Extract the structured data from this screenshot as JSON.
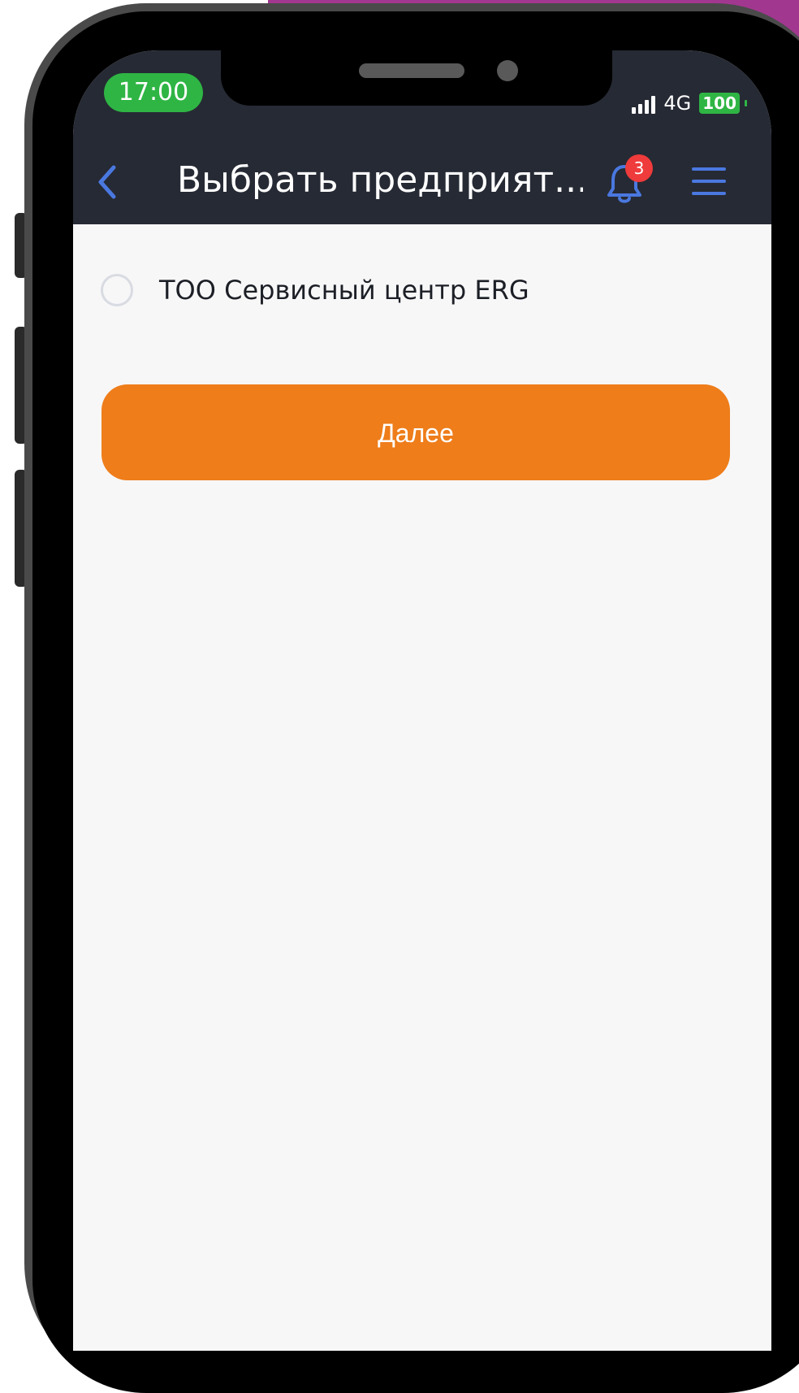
{
  "status_bar": {
    "time": "17:00",
    "network": "4G",
    "battery": "100"
  },
  "header": {
    "title": "Выбрать предприят...",
    "notification_count": "3",
    "back_icon": "chevron-left-icon",
    "bell_icon": "bell-icon",
    "menu_icon": "hamburger-menu-icon"
  },
  "options": [
    {
      "label": "ТОО Сервисный центр ERG",
      "selected": false
    }
  ],
  "actions": {
    "next_label": "Далее"
  },
  "colors": {
    "header_bg": "#262a34",
    "accent_blue": "#4a78e0",
    "primary_button": "#ee7d1a",
    "status_green": "#2fb544",
    "badge_red": "#ef3b3b",
    "background_accent": "#a2378f"
  }
}
